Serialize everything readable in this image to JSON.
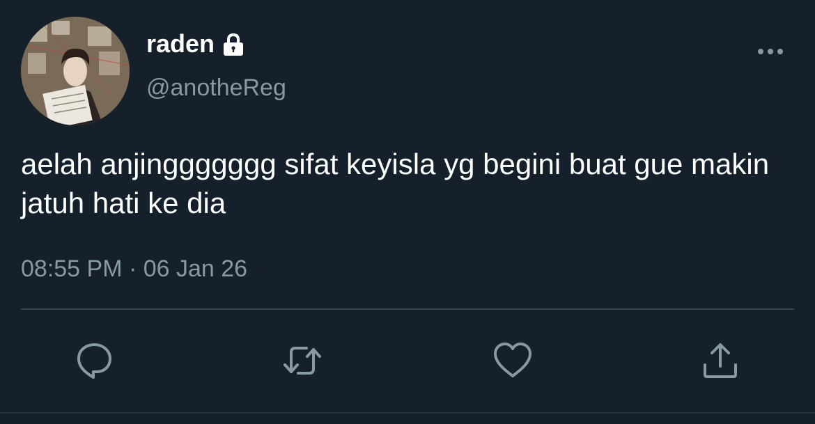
{
  "colors": {
    "background": "#15202b",
    "primary_text": "#ffffff",
    "secondary_text": "#8899a6",
    "divider": "#38444d",
    "icon": "#8899a6"
  },
  "tweet": {
    "author": {
      "display_name": "raden",
      "handle": "@anotheReg",
      "protected_icon": "lock-icon",
      "avatar": "profile-photo"
    },
    "more_icon": "more-dots-icon",
    "text": "aelah anjinggggggg sifat keyisla yg begini buat gue makin jatuh hati ke dia",
    "timestamp": "08:55 PM · 06 Jan 26"
  },
  "actions": [
    {
      "name": "reply",
      "icon": "reply-icon"
    },
    {
      "name": "retweet",
      "icon": "retweet-icon"
    },
    {
      "name": "like",
      "icon": "heart-icon"
    },
    {
      "name": "share",
      "icon": "share-icon"
    }
  ]
}
